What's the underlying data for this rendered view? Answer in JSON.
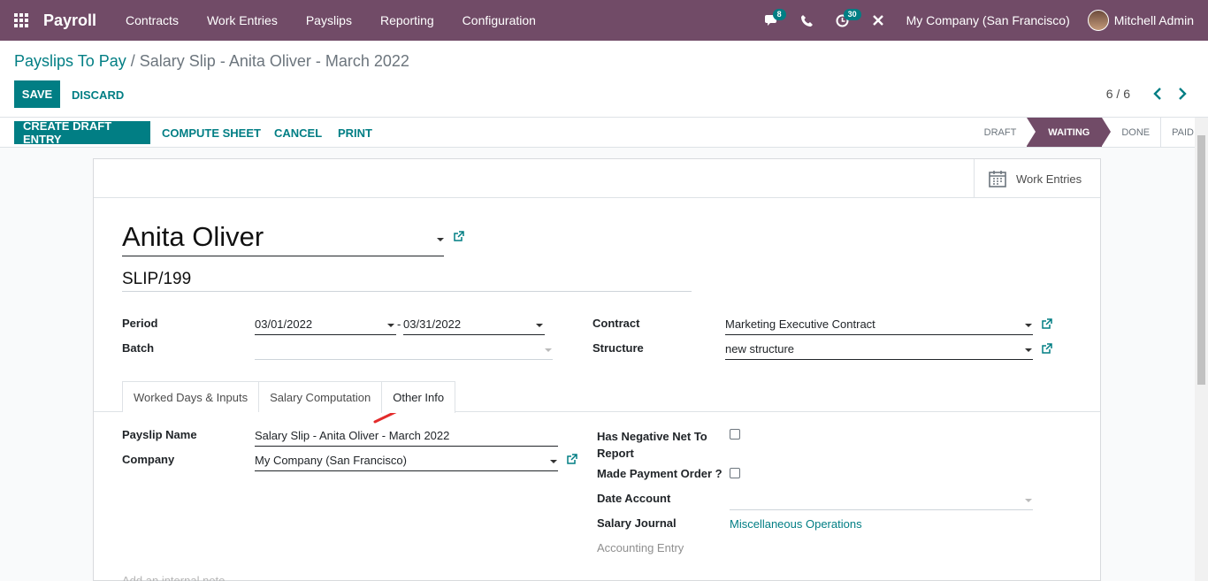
{
  "navbar": {
    "app_name": "Payroll",
    "menu": [
      "Contracts",
      "Work Entries",
      "Payslips",
      "Reporting",
      "Configuration"
    ],
    "messages_count": "8",
    "activities_count": "30",
    "company": "My Company (San Francisco)",
    "user": "Mitchell Admin"
  },
  "control": {
    "breadcrumb_parent": "Payslips To Pay",
    "breadcrumb_sep": "/",
    "breadcrumb_current": "Salary Slip - Anita Oliver - March 2022",
    "save_label": "SAVE",
    "discard_label": "DISCARD",
    "pager": "6 / 6"
  },
  "statusbar": {
    "buttons": [
      "CREATE DRAFT ENTRY",
      "COMPUTE SHEET",
      "CANCEL",
      "PRINT"
    ],
    "stages": [
      "DRAFT",
      "WAITING",
      "DONE",
      "PAID"
    ],
    "active_stage": "WAITING"
  },
  "sheet": {
    "work_entries_label": "Work Entries",
    "employee": "Anita Oliver",
    "reference": "SLIP/199",
    "period_label": "Period",
    "period_from": "03/01/2022",
    "period_dash": "-",
    "period_to": "03/31/2022",
    "batch_label": "Batch",
    "batch_value": "",
    "contract_label": "Contract",
    "contract_value": "Marketing Executive Contract",
    "structure_label": "Structure",
    "structure_value": "new structure",
    "tabs": [
      "Worked Days & Inputs",
      "Salary Computation",
      "Other Info"
    ],
    "active_tab": "Other Info",
    "other_info": {
      "payslip_name_label": "Payslip Name",
      "payslip_name_value": "Salary Slip - Anita Oliver - March 2022",
      "company_label": "Company",
      "company_value": "My Company (San Francisco)",
      "negative_net_label_1": "Has Negative Net To",
      "negative_net_label_2": "Report",
      "negative_net_checked": false,
      "payment_order_label": "Made Payment Order ?",
      "payment_order_checked": false,
      "date_account_label": "Date Account",
      "date_account_value": "",
      "salary_journal_label": "Salary Journal",
      "salary_journal_value": "Miscellaneous Operations",
      "accounting_entry_label": "Accounting Entry"
    },
    "note_placeholder": "Add an internal note..."
  },
  "colors": {
    "brand": "#714b67",
    "accent": "#017e84",
    "annotation_arrow": "#e32b2b"
  }
}
